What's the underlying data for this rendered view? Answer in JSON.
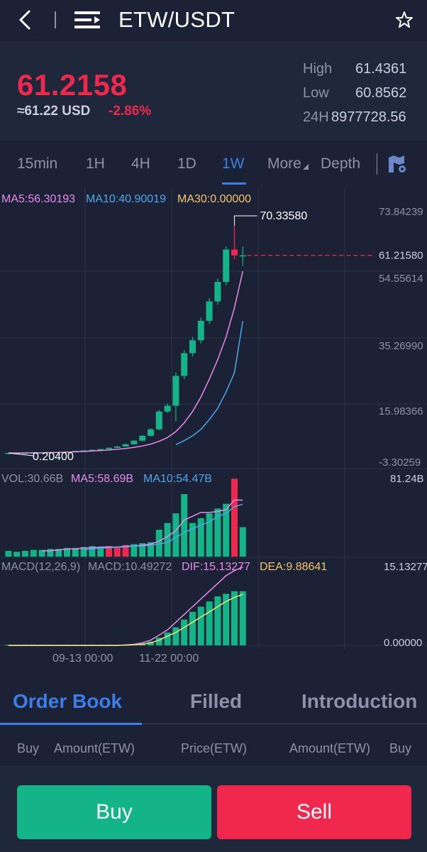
{
  "header": {
    "title": "ETW/USDT",
    "back_icon": "chevron-left-icon",
    "menu_icon": "menu-icon",
    "favorite_icon": "star-icon"
  },
  "ticker": {
    "price": "61.2158",
    "usd_value": "≈61.22 USD",
    "change": "-2.86%",
    "high_label": "High",
    "high_value": "61.4361",
    "low_label": "Low",
    "low_value": "60.8562",
    "vol_label": "24H",
    "vol_value": "8977728.56"
  },
  "timeframes": {
    "tabs": [
      "15min",
      "1H",
      "4H",
      "1D",
      "1W",
      "More",
      "Depth"
    ],
    "active": "1W"
  },
  "colors": {
    "accent": "#3d7de6",
    "up": "#13b487",
    "down": "#f0284e",
    "ma5": "#e98be6",
    "ma10": "#4da6ea",
    "ma30": "#f5c46a"
  },
  "chart_data": {
    "type": "candlestick",
    "indicators": {
      "ma5": "MA5:56.30193",
      "ma10": "MA10:40.90019",
      "ma30": "MA30:0.00000"
    },
    "price_axis": [
      "73.84239",
      "54.55614",
      "35.26990",
      "15.98366",
      "-3.30259"
    ],
    "ylim": [
      -3.30259,
      73.84239
    ],
    "max_label": "70.33580",
    "min_label": "0.20400",
    "current_price": "61.21580",
    "candles": [
      [
        0.2,
        0.2,
        0.2,
        0.2
      ],
      [
        0.2,
        0.25,
        0.15,
        0.22
      ],
      [
        0.22,
        0.3,
        0.18,
        0.25
      ],
      [
        0.25,
        0.35,
        0.2,
        0.3
      ],
      [
        0.3,
        0.4,
        0.25,
        0.35
      ],
      [
        0.35,
        0.5,
        0.3,
        0.45
      ],
      [
        0.45,
        0.6,
        0.4,
        0.55
      ],
      [
        0.55,
        0.7,
        0.5,
        0.65
      ],
      [
        0.65,
        0.9,
        0.6,
        0.85
      ],
      [
        0.85,
        1.1,
        0.8,
        1.0
      ],
      [
        1.0,
        1.3,
        0.95,
        1.2
      ],
      [
        1.2,
        1.5,
        1.1,
        1.4
      ],
      [
        1.4,
        1.9,
        1.3,
        1.8
      ],
      [
        1.8,
        2.4,
        1.7,
        2.2
      ],
      [
        2.2,
        3.1,
        2.1,
        2.9
      ],
      [
        2.9,
        4.2,
        2.8,
        4.0
      ],
      [
        4.0,
        5.8,
        3.8,
        5.5
      ],
      [
        5.5,
        7.8,
        5.3,
        7.5
      ],
      [
        7.5,
        13.5,
        7.2,
        13.0
      ],
      [
        13.0,
        15.5,
        12.5,
        14.8
      ],
      [
        14.8,
        25.0,
        10.0,
        24.0
      ],
      [
        24.0,
        32.0,
        23.0,
        31.0
      ],
      [
        31.0,
        36.0,
        30.0,
        35.0
      ],
      [
        35.0,
        42.0,
        34.0,
        41.0
      ],
      [
        41.0,
        48.0,
        40.0,
        47.0
      ],
      [
        47.0,
        54.0,
        46.0,
        53.0
      ],
      [
        53.0,
        64.0,
        52.0,
        63.0
      ],
      [
        63.0,
        70.3358,
        60.0,
        61.2
      ],
      [
        61.2,
        64.0,
        58.0,
        61.2158
      ]
    ],
    "ma5_line": [
      0.2,
      0.21,
      0.22,
      0.24,
      0.27,
      0.31,
      0.37,
      0.45,
      0.55,
      0.67,
      0.8,
      0.95,
      1.13,
      1.34,
      1.6,
      1.94,
      2.36,
      2.95,
      3.8,
      4.95,
      6.8,
      9.5,
      13.0,
      17.5,
      23.0,
      29.0,
      36.0,
      45.0,
      56.30193
    ],
    "ma10_line": [
      null,
      null,
      null,
      null,
      null,
      null,
      null,
      null,
      null,
      null,
      null,
      null,
      null,
      null,
      null,
      null,
      null,
      null,
      null,
      null,
      2.8,
      4.0,
      5.5,
      7.5,
      10.5,
      14.0,
      19.0,
      25.0,
      40.90019
    ],
    "volume": {
      "label": "VOL:30.66B",
      "ma5": "MA5:58.69B",
      "ma10": "MA10:54.47B",
      "axis_max": "81.24B",
      "ylim": [
        0,
        81.24
      ],
      "bars": [
        6,
        5,
        6,
        7,
        7,
        8,
        8,
        9,
        9,
        10,
        11,
        10,
        11,
        10,
        12,
        13,
        14,
        15,
        28,
        35,
        45,
        65,
        35,
        40,
        45,
        50,
        55,
        81,
        30.66
      ],
      "down": [
        false,
        false,
        false,
        false,
        false,
        false,
        false,
        false,
        false,
        false,
        false,
        false,
        true,
        true,
        true,
        false,
        false,
        false,
        false,
        false,
        false,
        false,
        false,
        false,
        false,
        false,
        false,
        true,
        false
      ],
      "ma5_line": [
        null,
        null,
        null,
        null,
        6,
        6,
        7,
        8,
        8,
        9,
        9,
        10,
        10,
        10,
        11,
        11,
        12,
        13,
        16,
        21,
        27,
        38,
        42,
        46,
        46,
        47,
        49,
        59,
        58.69
      ],
      "ma10_line": [
        null,
        null,
        null,
        null,
        null,
        null,
        null,
        null,
        null,
        7,
        8,
        9,
        9,
        10,
        10,
        11,
        11,
        12,
        13,
        15,
        20,
        25,
        29,
        33,
        36,
        42,
        45,
        52,
        54.47
      ]
    },
    "macd": {
      "label": "MACD(12,26,9)",
      "macd": "MACD:10.49272",
      "dif": "DIF:15.13277",
      "dea": "DEA:9.88641",
      "axis_max": "15.13277",
      "axis_min": "0.00000",
      "ylim": [
        0,
        15.13277
      ],
      "bars": [
        0,
        0,
        0,
        0,
        0,
        0,
        0,
        0,
        0,
        0,
        0,
        0,
        0,
        0,
        0.1,
        0.2,
        0.4,
        0.7,
        1.5,
        2.5,
        3.5,
        5.0,
        6.5,
        7.5,
        8.5,
        9.5,
        10.0,
        10.5,
        10.49272
      ],
      "dif_line": [
        0,
        0,
        0,
        0,
        0,
        0,
        0,
        0,
        0,
        0,
        0,
        0,
        0,
        0,
        0.1,
        0.2,
        0.5,
        1.0,
        2.0,
        3.0,
        4.5,
        6.0,
        7.5,
        9.0,
        10.5,
        12.0,
        13.5,
        14.5,
        15.13277
      ],
      "dea_line": [
        0,
        0,
        0,
        0,
        0,
        0,
        0,
        0,
        0,
        0,
        0,
        0,
        0,
        0,
        0.05,
        0.1,
        0.2,
        0.5,
        1.0,
        1.8,
        2.5,
        3.5,
        4.5,
        5.5,
        6.5,
        7.5,
        8.5,
        9.3,
        9.88641
      ]
    },
    "date_labels": [
      "09-13 00:00",
      "11-22 00:00"
    ]
  },
  "order_book": {
    "tabs": [
      "Order Book",
      "Filled",
      "Introduction"
    ],
    "columns": [
      "Buy",
      "Amount(ETW)",
      "Price(ETW)",
      "Amount(ETW)",
      "Buy"
    ]
  },
  "actions": {
    "buy_label": "Buy",
    "sell_label": "Sell"
  }
}
